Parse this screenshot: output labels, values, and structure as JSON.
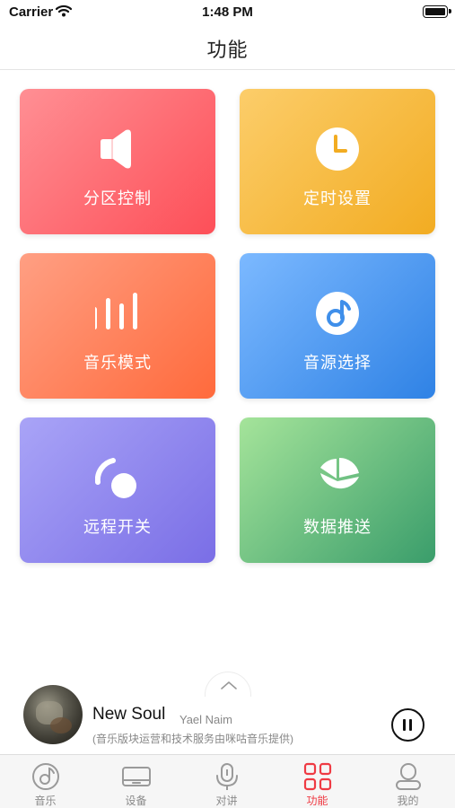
{
  "status_bar": {
    "carrier": "Carrier",
    "time": "1:48 PM"
  },
  "nav": {
    "title": "功能"
  },
  "tiles": [
    {
      "label": "分区控制",
      "icon": "speaker-icon",
      "color_start": "#ff8f94",
      "color_end": "#fd4f58"
    },
    {
      "label": "定时设置",
      "icon": "clock-icon",
      "color_start": "#fccd6a",
      "color_end": "#f2ac22"
    },
    {
      "label": "音乐模式",
      "icon": "equalizer-bars-icon",
      "color_start": "#ff9f83",
      "color_end": "#ff6a3c"
    },
    {
      "label": "音源选择",
      "icon": "music-disc-icon",
      "color_start": "#7cb9ff",
      "color_end": "#2f82e5"
    },
    {
      "label": "远程开关",
      "icon": "remote-switch-icon",
      "color_start": "#a9a4f7",
      "color_end": "#7a6ee6"
    },
    {
      "label": "数据推送",
      "icon": "pie-chart-icon",
      "color_start": "#a5e49a",
      "color_end": "#3a9d6b"
    }
  ],
  "player": {
    "title": "New Soul",
    "artist": "Yael Naim",
    "credit": "(音乐版块运营和技术服务由咪咕音乐提供)"
  },
  "tab_bar": {
    "active_color": "#ef3a43",
    "items": [
      {
        "label": "音乐",
        "icon": "music-disc-icon"
      },
      {
        "label": "设备",
        "icon": "device-icon"
      },
      {
        "label": "对讲",
        "icon": "microphone-icon"
      },
      {
        "label": "功能",
        "icon": "grid-icon",
        "active": true
      },
      {
        "label": "我的",
        "icon": "user-icon"
      }
    ]
  }
}
